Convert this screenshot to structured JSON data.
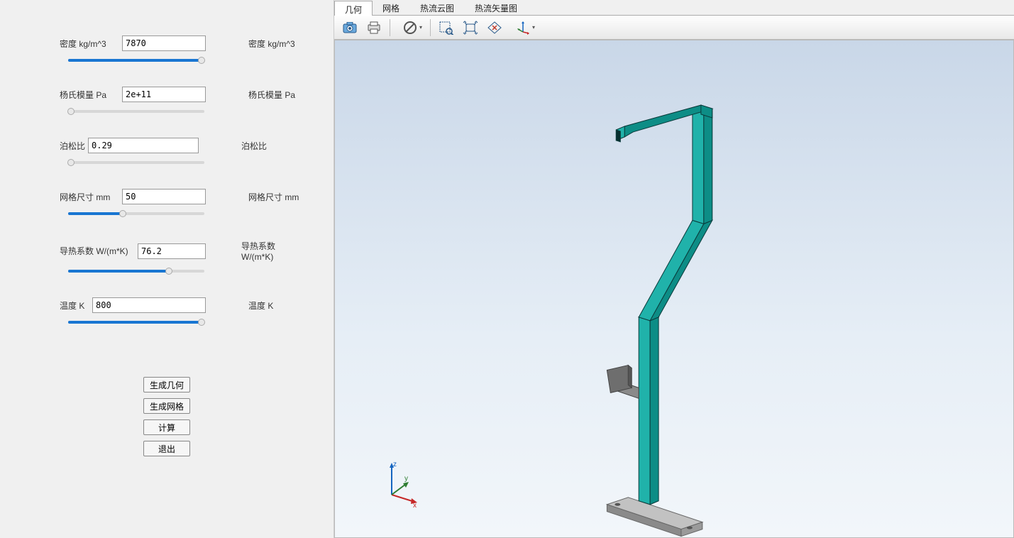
{
  "params": {
    "density": {
      "label": "密度 kg/m^3",
      "value": "7870",
      "right": "密度 kg/m^3",
      "fillPct": 98
    },
    "youngs": {
      "label": "杨氏模量 Pa",
      "value": "2e+11",
      "right": "杨氏模量 Pa",
      "fillPct": 2
    },
    "poisson": {
      "label": "泊松比",
      "value": "0.29",
      "right": "泊松比",
      "fillPct": 2
    },
    "mesh": {
      "label": "网格尺寸 mm",
      "value": "50",
      "right": "网格尺寸 mm",
      "fillPct": 40
    },
    "conduct": {
      "label": "导热系数 W/(m*K)",
      "value": "76.2",
      "right": "导热系数 W/(m*K)",
      "fillPct": 74
    },
    "temp": {
      "label": "温度 K",
      "value": "800",
      "right": "温度 K",
      "fillPct": 98
    }
  },
  "buttons": {
    "genGeom": "生成几何",
    "genMesh": "生成网格",
    "compute": "计算",
    "exit": "退出"
  },
  "tabs": {
    "geom": "几何",
    "mesh": "网格",
    "cloud": "热流云图",
    "vector": "热流矢量图"
  },
  "triad": {
    "x": "x",
    "y": "y",
    "z": "z"
  },
  "colors": {
    "model_face": "#20b2aa",
    "model_face_light": "#4ec9c1",
    "model_face_dark": "#0d8d86",
    "plate": "#a8a8a8",
    "plate_dark": "#8a8a8a",
    "edge": "#0a3a3a"
  }
}
